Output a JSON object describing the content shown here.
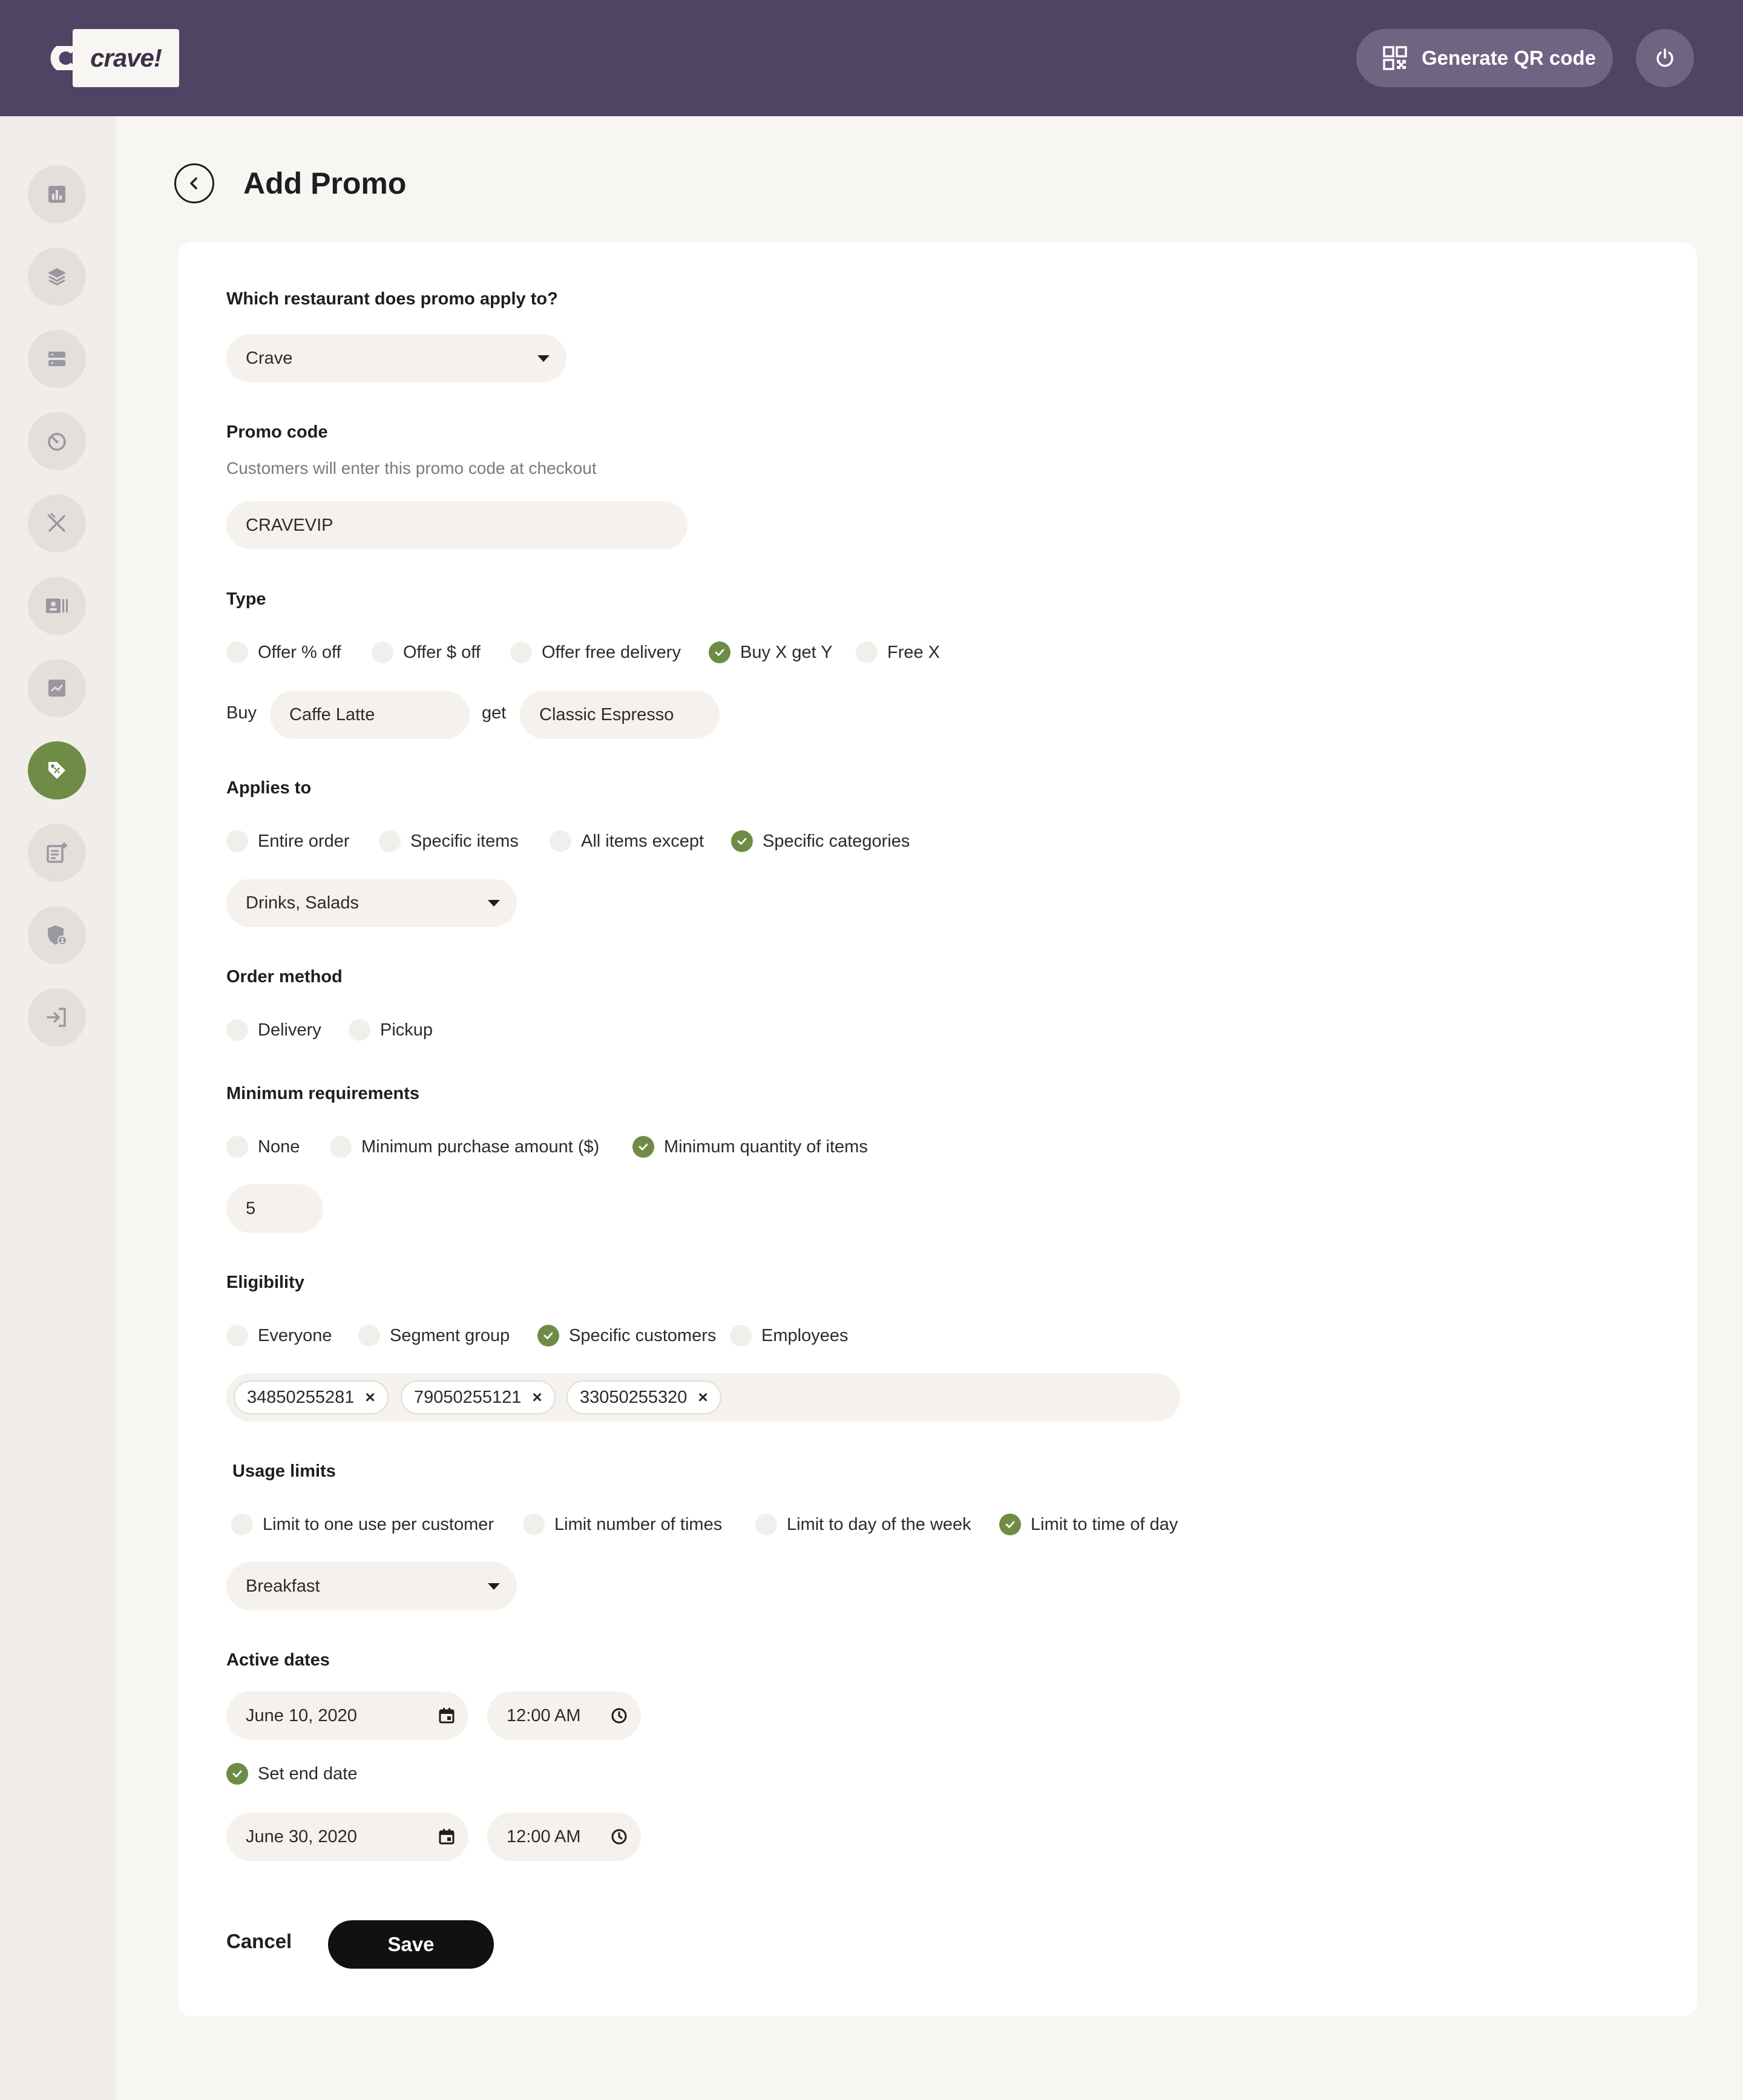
{
  "header": {
    "logo_text": "crave!",
    "qr_button_label": "Generate QR code",
    "colors": {
      "bar": "#4f4464",
      "button": "#6f6582"
    }
  },
  "sidebar": {
    "items": [
      {
        "icon": "bar-chart-icon",
        "active": false
      },
      {
        "icon": "layers-icon",
        "active": false
      },
      {
        "icon": "server-icon",
        "active": false
      },
      {
        "icon": "timer-icon",
        "active": false
      },
      {
        "icon": "utensils-icon",
        "active": false
      },
      {
        "icon": "contact-card-icon",
        "active": false
      },
      {
        "icon": "trending-icon",
        "active": false
      },
      {
        "icon": "tag-icon",
        "active": true
      },
      {
        "icon": "add-note-icon",
        "active": false
      },
      {
        "icon": "shield-user-icon",
        "active": false
      },
      {
        "icon": "sign-in-icon",
        "active": false
      }
    ],
    "active_color": "#6e8c46"
  },
  "page": {
    "title": "Add Promo"
  },
  "form": {
    "restaurant": {
      "label": "Which restaurant does promo apply to?",
      "value": "Crave"
    },
    "promo_code": {
      "label": "Promo code",
      "helper": "Customers will enter this promo code at checkout",
      "value": "CRAVEVIP"
    },
    "type": {
      "label": "Type",
      "options": [
        "Offer % off",
        "Offer $ off",
        "Offer free delivery",
        "Buy X get Y",
        "Free X"
      ],
      "selected": "Buy X get Y",
      "buy_word": "Buy",
      "buy_value": "Caffe Latte",
      "get_word": "get",
      "get_value": "Classic Espresso"
    },
    "applies_to": {
      "label": "Applies to",
      "options": [
        "Entire order",
        "Specific items",
        "All items except",
        "Specific categories"
      ],
      "selected": "Specific categories",
      "value": "Drinks, Salads"
    },
    "order_method": {
      "label": "Order method",
      "options": [
        "Delivery",
        "Pickup"
      ]
    },
    "minimum": {
      "label": "Minimum requirements",
      "options": [
        "None",
        "Minimum purchase amount ($)",
        "Minimum quantity of items"
      ],
      "selected": "Minimum quantity of items",
      "value": "5"
    },
    "eligibility": {
      "label": "Eligibility",
      "options": [
        "Everyone",
        "Segment group",
        "Specific customers",
        "Employees"
      ],
      "selected": "Specific customers",
      "customers": [
        "34850255281",
        "79050255121",
        "33050255320"
      ]
    },
    "usage": {
      "label": "Usage limits",
      "options": [
        "Limit to one use per customer",
        "Limit number of times",
        "Limit to day of the week",
        "Limit to time of day"
      ],
      "selected": "Limit to time of day",
      "value": "Breakfast"
    },
    "dates": {
      "label": "Active dates",
      "start_date": "June 10, 2020",
      "start_time": "12:00 AM",
      "set_end_label": "Set end date",
      "set_end_checked": true,
      "end_date": "June 30, 2020",
      "end_time": "12:00 AM"
    },
    "actions": {
      "cancel": "Cancel",
      "save": "Save"
    }
  }
}
